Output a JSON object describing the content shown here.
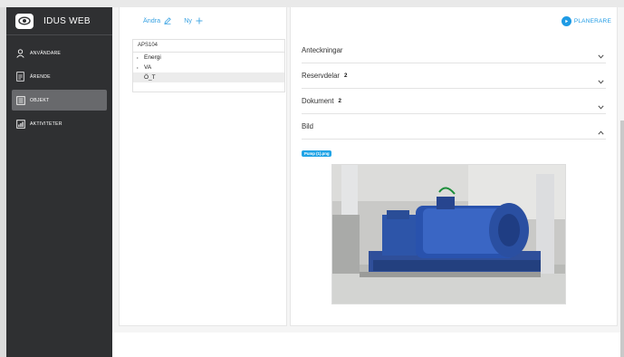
{
  "app": {
    "title": "IDUS WEB"
  },
  "sidebar": {
    "items": [
      {
        "label": "ANVÄNDARE",
        "icon": "user-icon",
        "active": false
      },
      {
        "label": "ÄRENDE",
        "icon": "document-icon",
        "active": false
      },
      {
        "label": "OBJEKT",
        "icon": "object-list-icon",
        "active": true
      },
      {
        "label": "AKTIVITETER",
        "icon": "chart-icon",
        "active": false
      }
    ]
  },
  "toolbar": {
    "edit_label": "Ändra",
    "new_label": "Ny"
  },
  "tree": {
    "root": "APS104",
    "items": [
      {
        "label": "Energi",
        "expandable": true,
        "selected": false
      },
      {
        "label": "VA",
        "expandable": true,
        "selected": false
      },
      {
        "label": "Ö_T",
        "expandable": false,
        "selected": true
      }
    ]
  },
  "header": {
    "planerare_label": "PLANERARE"
  },
  "accordions": [
    {
      "title": "Anteckningar",
      "count": "",
      "expanded": false
    },
    {
      "title": "Reservdelar",
      "count": "2",
      "expanded": false
    },
    {
      "title": "Dokument",
      "count": "2",
      "expanded": false
    },
    {
      "title": "Bild",
      "count": "",
      "expanded": true
    }
  ],
  "image": {
    "filename": "Pump (1).png"
  },
  "colors": {
    "sidebar": "#2f3032",
    "accent": "#1e9be5",
    "active_nav": "#68696c"
  }
}
